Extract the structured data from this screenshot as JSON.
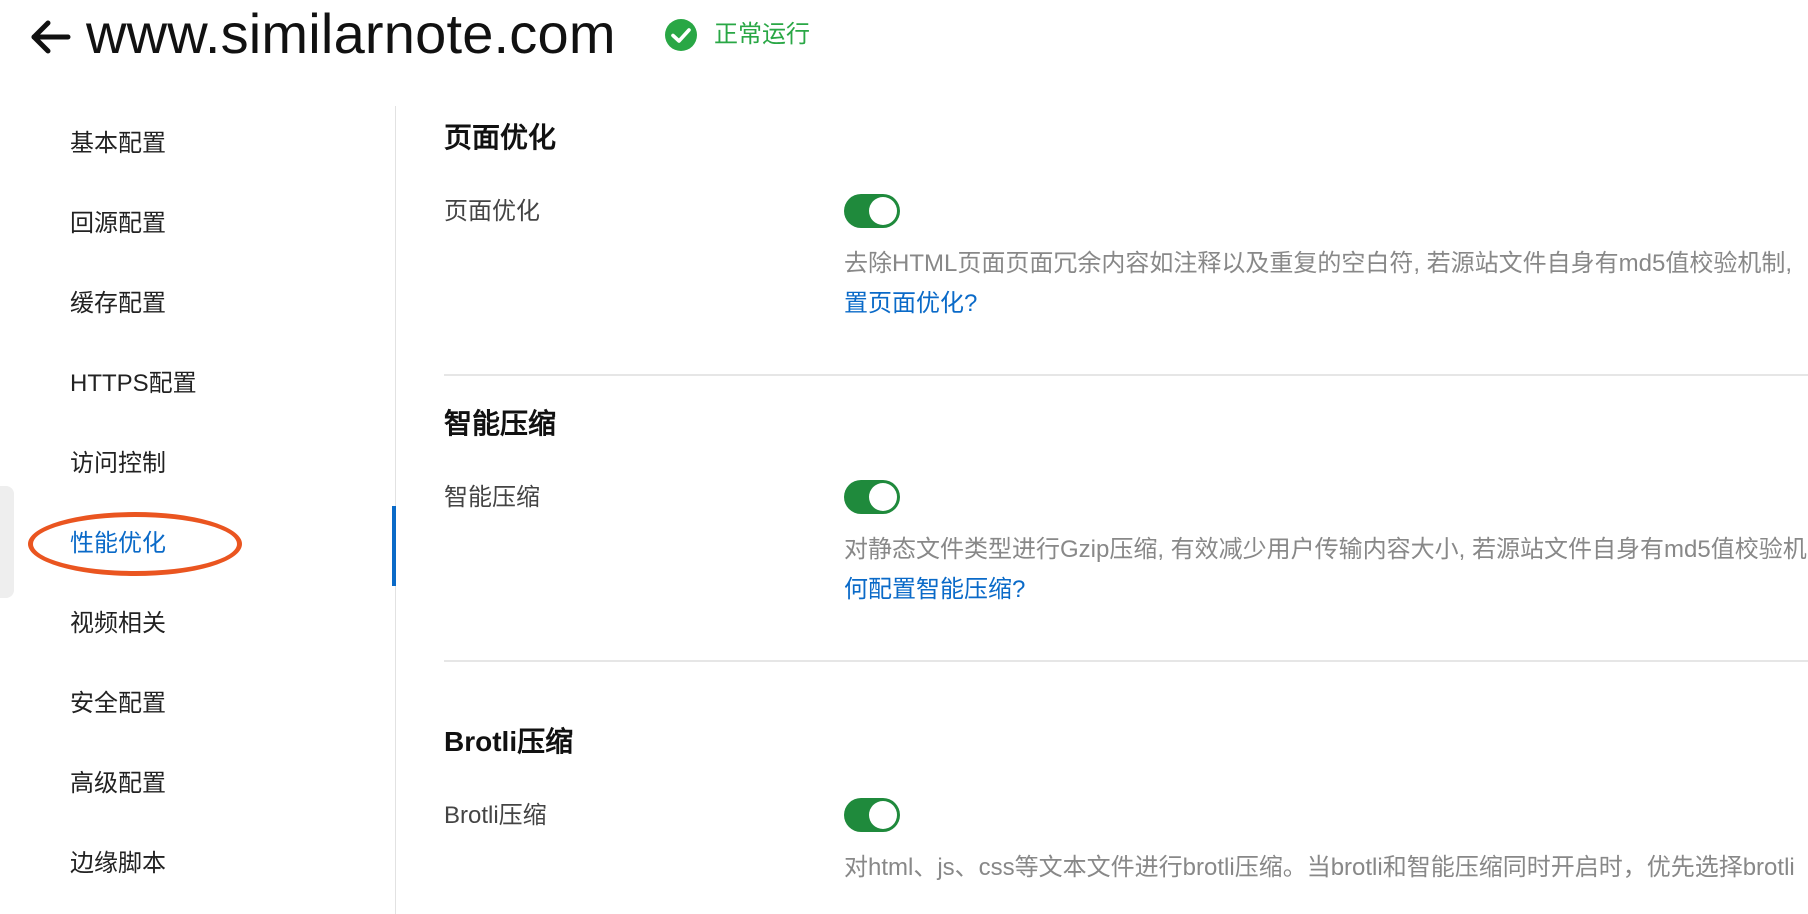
{
  "header": {
    "back_icon": "arrow-left-icon",
    "domain": "www.similarnote.com",
    "status_icon": "check-circle-icon",
    "status_text": "正常运行",
    "status_color": "#29a745"
  },
  "sidebar": {
    "items": [
      {
        "label": "基本配置"
      },
      {
        "label": "回源配置"
      },
      {
        "label": "缓存配置"
      },
      {
        "label": "HTTPS配置"
      },
      {
        "label": "访问控制"
      },
      {
        "label": "性能优化",
        "active": true
      },
      {
        "label": "视频相关"
      },
      {
        "label": "安全配置"
      },
      {
        "label": "高级配置"
      },
      {
        "label": "边缘脚本"
      }
    ],
    "active_color": "#0a6ac8",
    "highlight_color": "#ea5520"
  },
  "sections": [
    {
      "title": "页面优化",
      "setting_label": "页面优化",
      "enabled": true,
      "description": "去除HTML页面页面冗余内容如注释以及重复的空白符, 若源站文件自身有md5值校验机制, ",
      "link": "置页面优化?"
    },
    {
      "title": "智能压缩",
      "setting_label": "智能压缩",
      "enabled": true,
      "description": "对静态文件类型进行Gzip压缩, 有效减少用户传输内容大小, 若源站文件自身有md5值校验机",
      "link": "何配置智能压缩?"
    },
    {
      "title": "Brotli压缩",
      "setting_label": "Brotli压缩",
      "enabled": true,
      "description": "对html、js、css等文本文件进行brotli压缩。当brotli和智能压缩同时开启时，优先选择brotli",
      "link": ""
    }
  ],
  "toggle_on_color": "#1f8a3c",
  "link_color": "#0a6ac8"
}
